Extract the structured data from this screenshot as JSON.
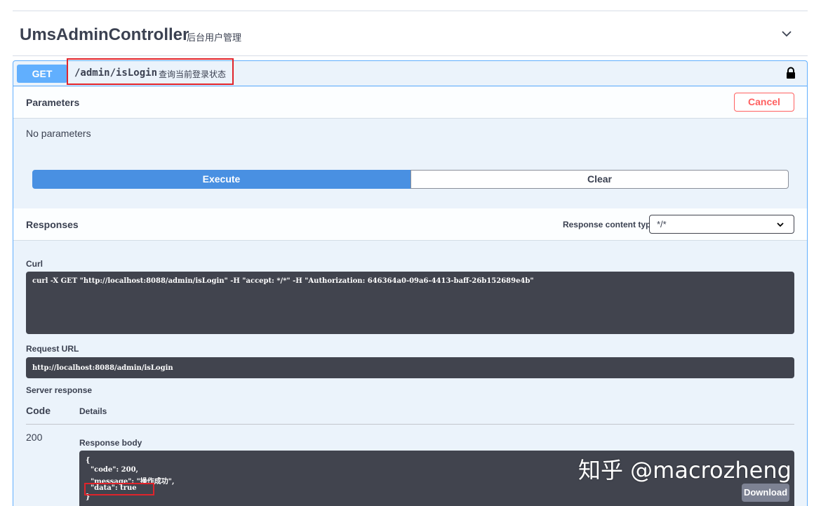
{
  "tag": {
    "name": "UmsAdminController",
    "description": "后台用户管理"
  },
  "operation": {
    "method": "GET",
    "path": "/admin/isLogin",
    "summary": "查询当前登录状态"
  },
  "parameters": {
    "title": "Parameters",
    "cancel_label": "Cancel",
    "empty_text": "No parameters"
  },
  "actions": {
    "execute_label": "Execute",
    "clear_label": "Clear"
  },
  "responses": {
    "title": "Responses",
    "content_type_label": "Response content type",
    "content_type_value": "*/*"
  },
  "curl": {
    "label": "Curl",
    "command": "curl -X GET \"http://localhost:8088/admin/isLogin\" -H \"accept: */*\" -H \"Authorization: 646364a0-09a6-4413-baff-26b152689e4b\""
  },
  "request_url": {
    "label": "Request URL",
    "value": "http://localhost:8088/admin/isLogin"
  },
  "server_response": {
    "label": "Server response",
    "code_header": "Code",
    "details_header": "Details",
    "code": "200",
    "body_label": "Response body",
    "body_lines": [
      "{",
      "  \"code\": 200,",
      "  \"message\": \"操作成功\",",
      "  \"data\": true",
      "}"
    ],
    "download_label": "Download"
  },
  "watermark": "知乎 @macrozheng"
}
